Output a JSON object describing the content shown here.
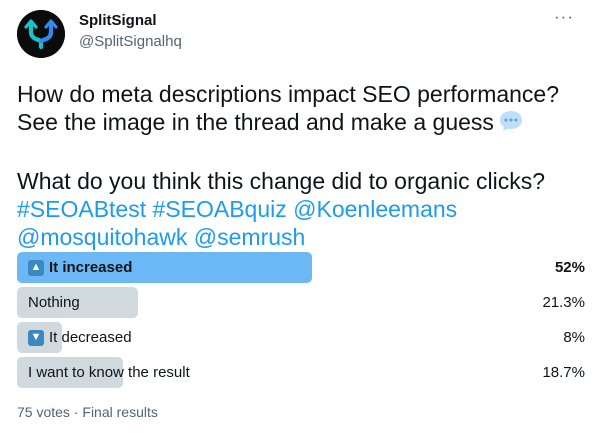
{
  "author": {
    "name": "SplitSignal",
    "handle": "@SplitSignalhq",
    "avatar_icon": "splitsignal-logo-icon"
  },
  "more_label": "···",
  "tweet": {
    "line1": "How do meta descriptions impact SEO performance?",
    "line2": "See the image in the thread and make a guess",
    "line3": "What do you think this change did to organic clicks?",
    "line4_tags": [
      "#SEOABtest",
      "#SEOABquiz",
      "@Koenleemans"
    ],
    "line5_tags": [
      "@mosquitohawk",
      "@semrush"
    ],
    "emoji_icon": "speech-bubble-icon"
  },
  "poll": {
    "options": [
      {
        "label": "It increased",
        "percent_text": "52%",
        "percent": 52,
        "winner": true,
        "icon": "arrow-up-icon"
      },
      {
        "label": "Nothing",
        "percent_text": "21.3%",
        "percent": 21.3,
        "winner": false,
        "icon": ""
      },
      {
        "label": "It decreased",
        "percent_text": "8%",
        "percent": 8,
        "winner": false,
        "icon": "arrow-down-icon"
      },
      {
        "label": "I want to know the result",
        "percent_text": "18.7%",
        "percent": 18.7,
        "winner": false,
        "icon": ""
      }
    ],
    "colors": {
      "winner": "#6cb8f5",
      "other": "#cfd9de"
    },
    "votes": "75 votes",
    "separator": "·",
    "status": "Final results"
  }
}
